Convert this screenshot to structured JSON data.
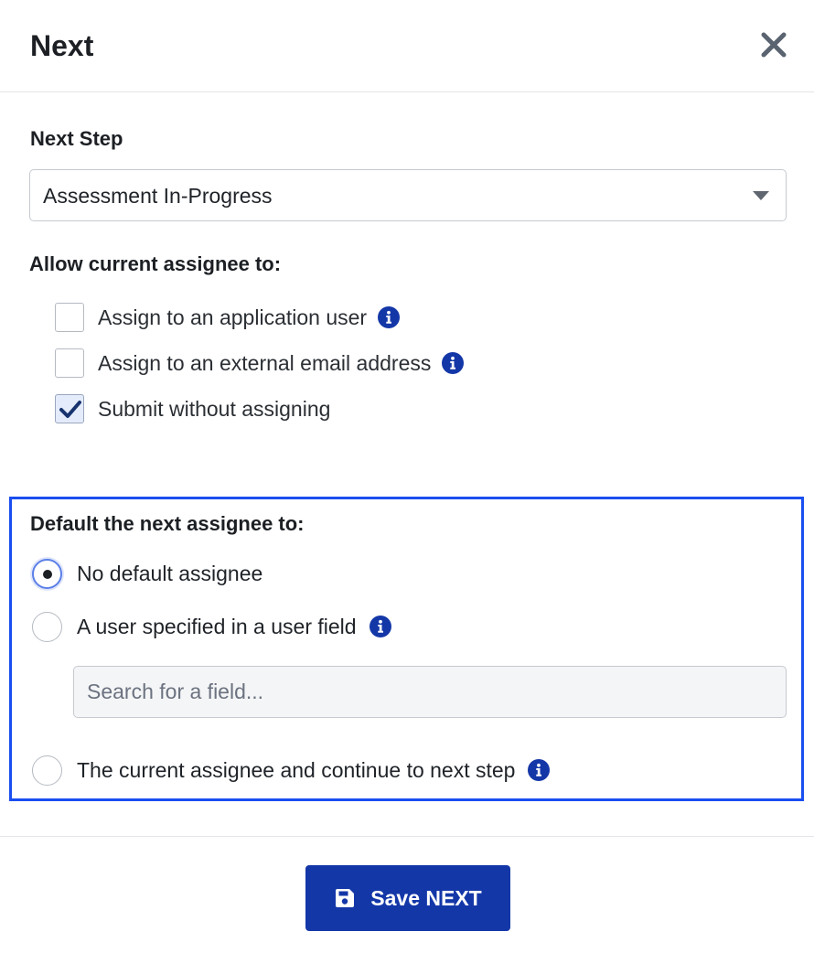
{
  "dialog": {
    "title": "Next",
    "close_icon": "close-icon"
  },
  "next_step": {
    "label": "Next Step",
    "selected": "Assessment In-Progress"
  },
  "allow": {
    "label": "Allow current assignee to:",
    "options": [
      {
        "label": "Assign to an application user",
        "checked": false,
        "info": true
      },
      {
        "label": "Assign to an external email address",
        "checked": false,
        "info": true
      },
      {
        "label": "Submit without assigning",
        "checked": true,
        "info": false
      }
    ]
  },
  "default_assignee": {
    "label": "Default the next assignee to:",
    "options": [
      {
        "label": "No default assignee",
        "selected": true
      },
      {
        "label": "A user specified in a user field",
        "selected": false,
        "info": true
      },
      {
        "label": "The current assignee and continue to next step",
        "selected": false,
        "info": true
      }
    ],
    "search_placeholder": "Search for a field..."
  },
  "footer": {
    "save_label": "Save NEXT",
    "save_icon": "floppy-disk-icon"
  },
  "colors": {
    "primary": "#1437a8",
    "highlight_border": "#1a4ef0",
    "info_icon": "#1437a8"
  }
}
